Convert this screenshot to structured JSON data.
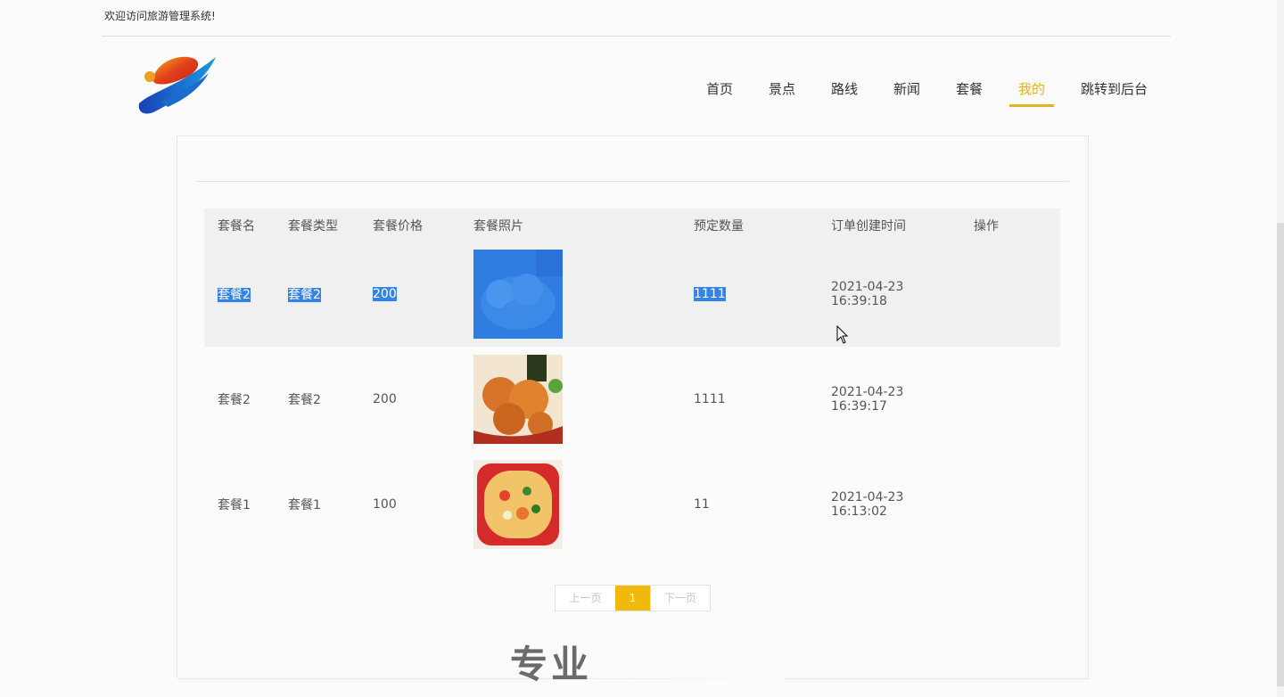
{
  "header": {
    "welcome": "欢迎访问旅游管理系统!"
  },
  "nav": {
    "items": [
      {
        "label": "首页"
      },
      {
        "label": "景点"
      },
      {
        "label": "路线"
      },
      {
        "label": "新闻"
      },
      {
        "label": "套餐"
      },
      {
        "label": "我的"
      },
      {
        "label": "跳转到后台"
      }
    ],
    "active": "我的",
    "accent": "#e6b21a"
  },
  "table": {
    "headers": [
      "套餐名",
      "套餐类型",
      "套餐价格",
      "套餐照片",
      "预定数量",
      "订单创建时间",
      "操作"
    ],
    "rows": [
      {
        "name": "套餐2",
        "type": "套餐2",
        "price": "200",
        "photo": "blue-food-photo",
        "qty": "1111",
        "date": "2021-04-23",
        "time": "16:39:18",
        "selected": true
      },
      {
        "name": "套餐2",
        "type": "套餐2",
        "price": "200",
        "photo": "fried-food-photo",
        "qty": "1111",
        "date": "2021-04-23",
        "time": "16:39:17"
      },
      {
        "name": "套餐1",
        "type": "套餐1",
        "price": "100",
        "photo": "noodle-bowl-photo",
        "qty": "11",
        "date": "2021-04-23",
        "time": "16:13:02"
      }
    ],
    "price_color": "#c1272d",
    "selection_color": "#3584e4"
  },
  "pager": {
    "prev": "上一页",
    "current": "1",
    "next": "下一页",
    "accent": "#f0b90b"
  },
  "watermark": {
    "text": "专业"
  }
}
